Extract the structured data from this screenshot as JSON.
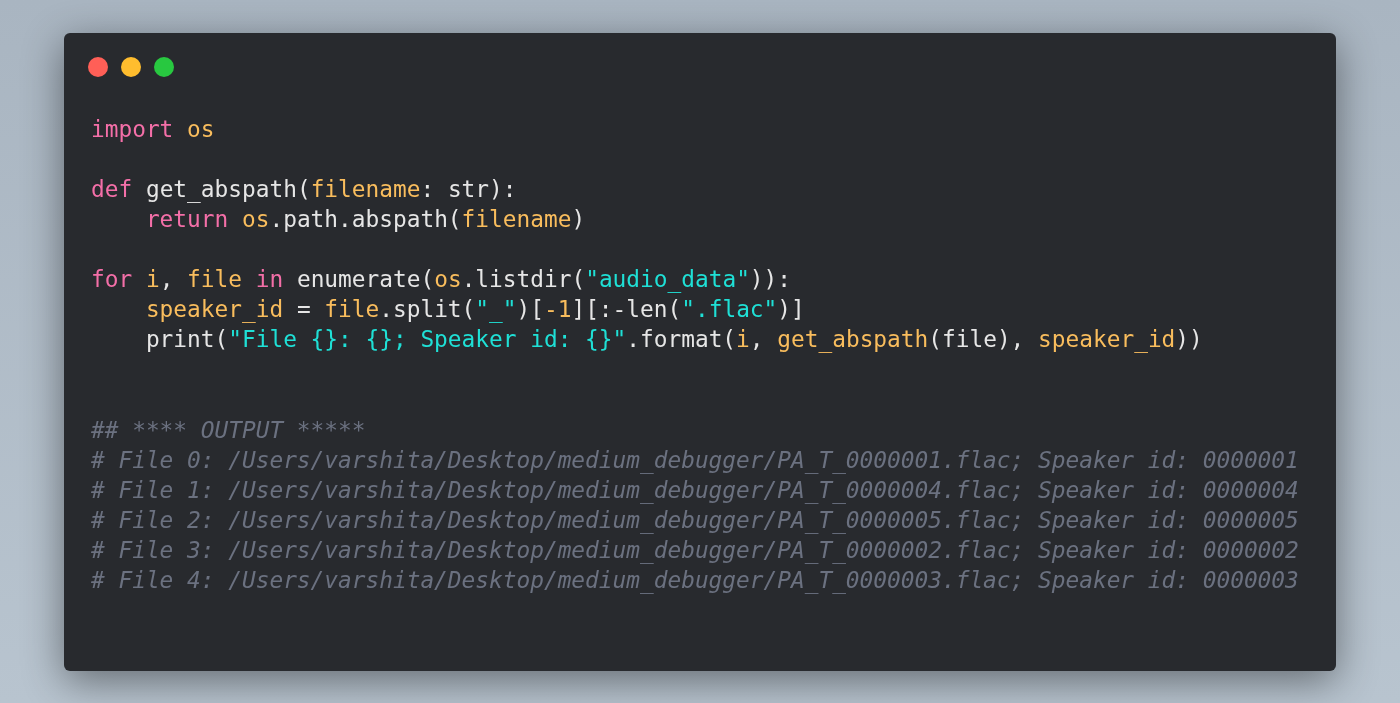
{
  "window_controls": [
    {
      "color": "#ff5f57"
    },
    {
      "color": "#ffbd2e"
    },
    {
      "color": "#28c840"
    }
  ],
  "code_blocks": [
    [
      {
        "tokens": [
          {
            "t": "import ",
            "kind": "kw"
          },
          {
            "t": "os",
            "kind": "var"
          }
        ]
      }
    ],
    [
      {
        "tokens": [
          {
            "t": "def",
            "kind": "kw"
          },
          {
            "t": " get_abspath(",
            "kind": "plain"
          },
          {
            "t": "filename",
            "kind": "var"
          },
          {
            "t": ": str):",
            "kind": "plain"
          }
        ]
      },
      {
        "tokens": [
          {
            "t": "    return ",
            "kind": "kw"
          },
          {
            "t": "os",
            "kind": "var"
          },
          {
            "t": ".path.abspath(",
            "kind": "plain"
          },
          {
            "t": "filename",
            "kind": "var"
          },
          {
            "t": ")",
            "kind": "plain"
          }
        ]
      }
    ],
    [
      {
        "tokens": [
          {
            "t": "for ",
            "kind": "kw"
          },
          {
            "t": "i",
            "kind": "var"
          },
          {
            "t": ", ",
            "kind": "plain"
          },
          {
            "t": "file",
            "kind": "var"
          },
          {
            "t": " in",
            "kind": "kw"
          },
          {
            "t": " enumerate(",
            "kind": "plain"
          },
          {
            "t": "os",
            "kind": "var"
          },
          {
            "t": ".listdir(",
            "kind": "plain"
          },
          {
            "t": "\"audio_data\"",
            "kind": "str"
          },
          {
            "t": ")):",
            "kind": "plain"
          }
        ]
      },
      {
        "tokens": [
          {
            "t": "    speaker_id",
            "kind": "var"
          },
          {
            "t": " = ",
            "kind": "plain"
          },
          {
            "t": "file",
            "kind": "var"
          },
          {
            "t": ".split(",
            "kind": "plain"
          },
          {
            "t": "\"_\"",
            "kind": "str"
          },
          {
            "t": ")[",
            "kind": "plain"
          },
          {
            "t": "-1",
            "kind": "var"
          },
          {
            "t": "][:-len(",
            "kind": "plain"
          },
          {
            "t": "\".flac\"",
            "kind": "str"
          },
          {
            "t": ")]",
            "kind": "plain"
          }
        ]
      },
      {
        "tokens": [
          {
            "t": "    print(",
            "kind": "plain"
          },
          {
            "t": "\"File {}: {}; Speaker id: {}\"",
            "kind": "str"
          },
          {
            "t": ".format(",
            "kind": "plain"
          },
          {
            "t": "i",
            "kind": "var"
          },
          {
            "t": ", ",
            "kind": "plain"
          },
          {
            "t": "get_abspath",
            "kind": "var"
          },
          {
            "t": "(file), ",
            "kind": "plain"
          },
          {
            "t": "speaker_id",
            "kind": "var"
          },
          {
            "t": "))",
            "kind": "plain"
          }
        ]
      }
    ]
  ],
  "output_lines": [
    "## **** OUTPUT *****",
    "# File 0: /Users/varshita/Desktop/medium_debugger/PA_T_0000001.flac; Speaker id: 0000001",
    "# File 1: /Users/varshita/Desktop/medium_debugger/PA_T_0000004.flac; Speaker id: 0000004",
    "# File 2: /Users/varshita/Desktop/medium_debugger/PA_T_0000005.flac; Speaker id: 0000005",
    "# File 3: /Users/varshita/Desktop/medium_debugger/PA_T_0000002.flac; Speaker id: 0000002",
    "# File 4: /Users/varshita/Desktop/medium_debugger/PA_T_0000003.flac; Speaker id: 0000003"
  ]
}
